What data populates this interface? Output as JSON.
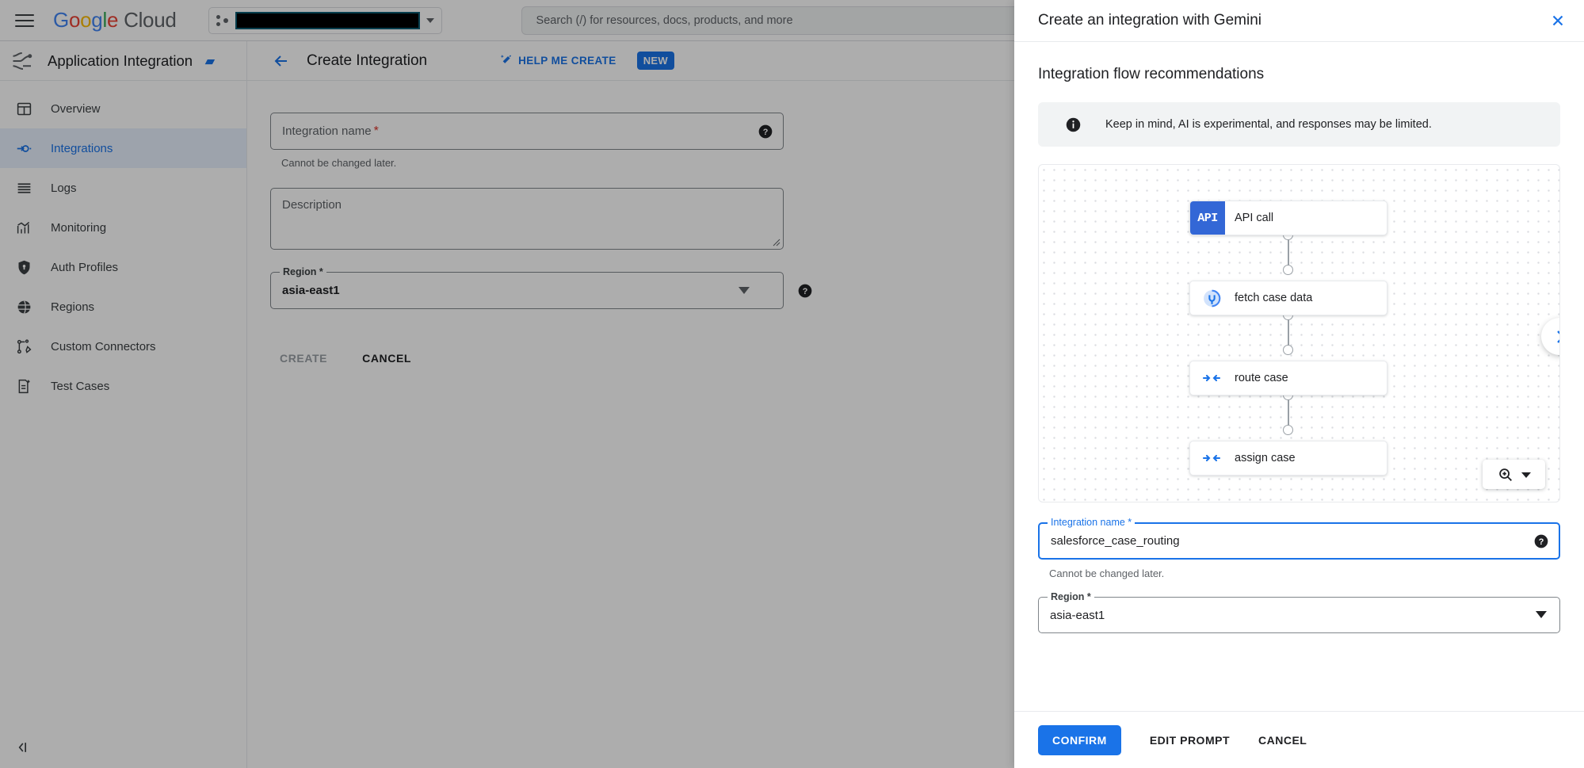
{
  "topbar": {
    "menu_icon": "hamburger-icon",
    "logo_google": "Google",
    "logo_cloud": "Cloud",
    "project_value": "",
    "search_placeholder": "Search (/) for resources, docs, products, and more"
  },
  "product_header": {
    "product_icon": "application-integration-icon",
    "product_name": "Application Integration",
    "product_badge": "▰",
    "back_icon": "back-arrow-icon",
    "page_title": "Create Integration",
    "help_me_create": "HELP ME CREATE",
    "help_icon": "magic-wand-icon",
    "new_badge": "NEW"
  },
  "sidebar": {
    "items": [
      {
        "label": "Overview",
        "icon": "dashboard-icon",
        "active": false
      },
      {
        "label": "Integrations",
        "icon": "integration-node-icon",
        "active": true
      },
      {
        "label": "Logs",
        "icon": "logs-icon",
        "active": false
      },
      {
        "label": "Monitoring",
        "icon": "monitoring-chart-icon",
        "active": false
      },
      {
        "label": "Auth Profiles",
        "icon": "shield-icon",
        "active": false
      },
      {
        "label": "Regions",
        "icon": "globe-icon",
        "active": false
      },
      {
        "label": "Custom Connectors",
        "icon": "connector-edit-icon",
        "active": false
      },
      {
        "label": "Test Cases",
        "icon": "test-file-icon",
        "active": false
      }
    ],
    "collapse_icon": "collapse-panel-icon"
  },
  "main_form": {
    "name_label": "Integration name",
    "name_required": "*",
    "name_value": "",
    "name_hint": "Cannot be changed later.",
    "description_placeholder": "Description",
    "region_label": "Region *",
    "region_value": "asia-east1",
    "create_button": "CREATE",
    "cancel_button": "CANCEL",
    "help_icon": "help-circle-icon"
  },
  "panel": {
    "title": "Create an integration with Gemini",
    "close_icon": "close-icon",
    "section_title": "Integration flow recommendations",
    "info_icon": "info-icon",
    "info_text": "Keep in mind, AI is experimental, and responses may be limited.",
    "flow": {
      "nodes": [
        {
          "label": "API call",
          "icon": "api-badge-icon",
          "kind": "api"
        },
        {
          "label": "fetch case data",
          "icon": "connector-plug-icon",
          "kind": "connector"
        },
        {
          "label": "route case",
          "icon": "data-mapping-icon",
          "kind": "mapping"
        },
        {
          "label": "assign case",
          "icon": "data-mapping-icon",
          "kind": "mapping"
        }
      ],
      "api_badge_text": "API",
      "next_icon": "chevron-right-icon",
      "zoom_icon": "zoom-in-icon",
      "zoom_caret": "chevron-down-icon"
    },
    "name_label": "Integration name *",
    "name_value": "salesforce_case_routing",
    "name_hint": "Cannot be changed later.",
    "name_help_icon": "help-circle-icon",
    "region_label": "Region *",
    "region_value": "asia-east1",
    "region_caret": "chevron-down-icon",
    "confirm_button": "CONFIRM",
    "edit_prompt_button": "EDIT PROMPT",
    "cancel_button": "CANCEL"
  },
  "colors": {
    "accent": "#1a73e8",
    "api_badge": "#3367d6",
    "required": "#d93025",
    "nav_active_bg": "#e8f0fe"
  }
}
